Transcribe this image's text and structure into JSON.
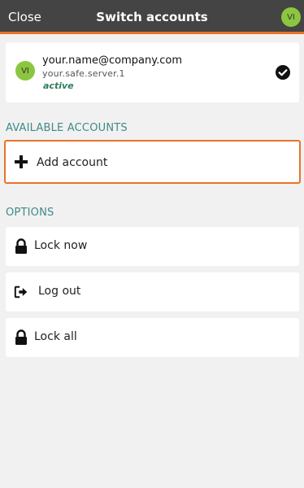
{
  "header": {
    "close_label": "Close",
    "title": "Switch accounts",
    "avatar_initials": "VI"
  },
  "account": {
    "avatar_initials": "VI",
    "email": "your.name@company.com",
    "server": "your.safe.server.1",
    "status": "active",
    "selected_icon": "check-circle-icon"
  },
  "available": {
    "section_label": "AVAILABLE ACCOUNTS",
    "add_label": "Add account",
    "add_icon": "plus-icon"
  },
  "options": {
    "section_label": "OPTIONS",
    "items": [
      {
        "label": "Lock now",
        "icon": "lock-icon"
      },
      {
        "label": "Log out",
        "icon": "logout-icon"
      },
      {
        "label": "Lock all",
        "icon": "lock-icon"
      }
    ]
  },
  "colors": {
    "accent": "#e8742b",
    "header_bg": "#444444",
    "avatar_bg": "#8cc63f",
    "section_label": "#3f8a88",
    "status_text": "#2e7d5b"
  }
}
